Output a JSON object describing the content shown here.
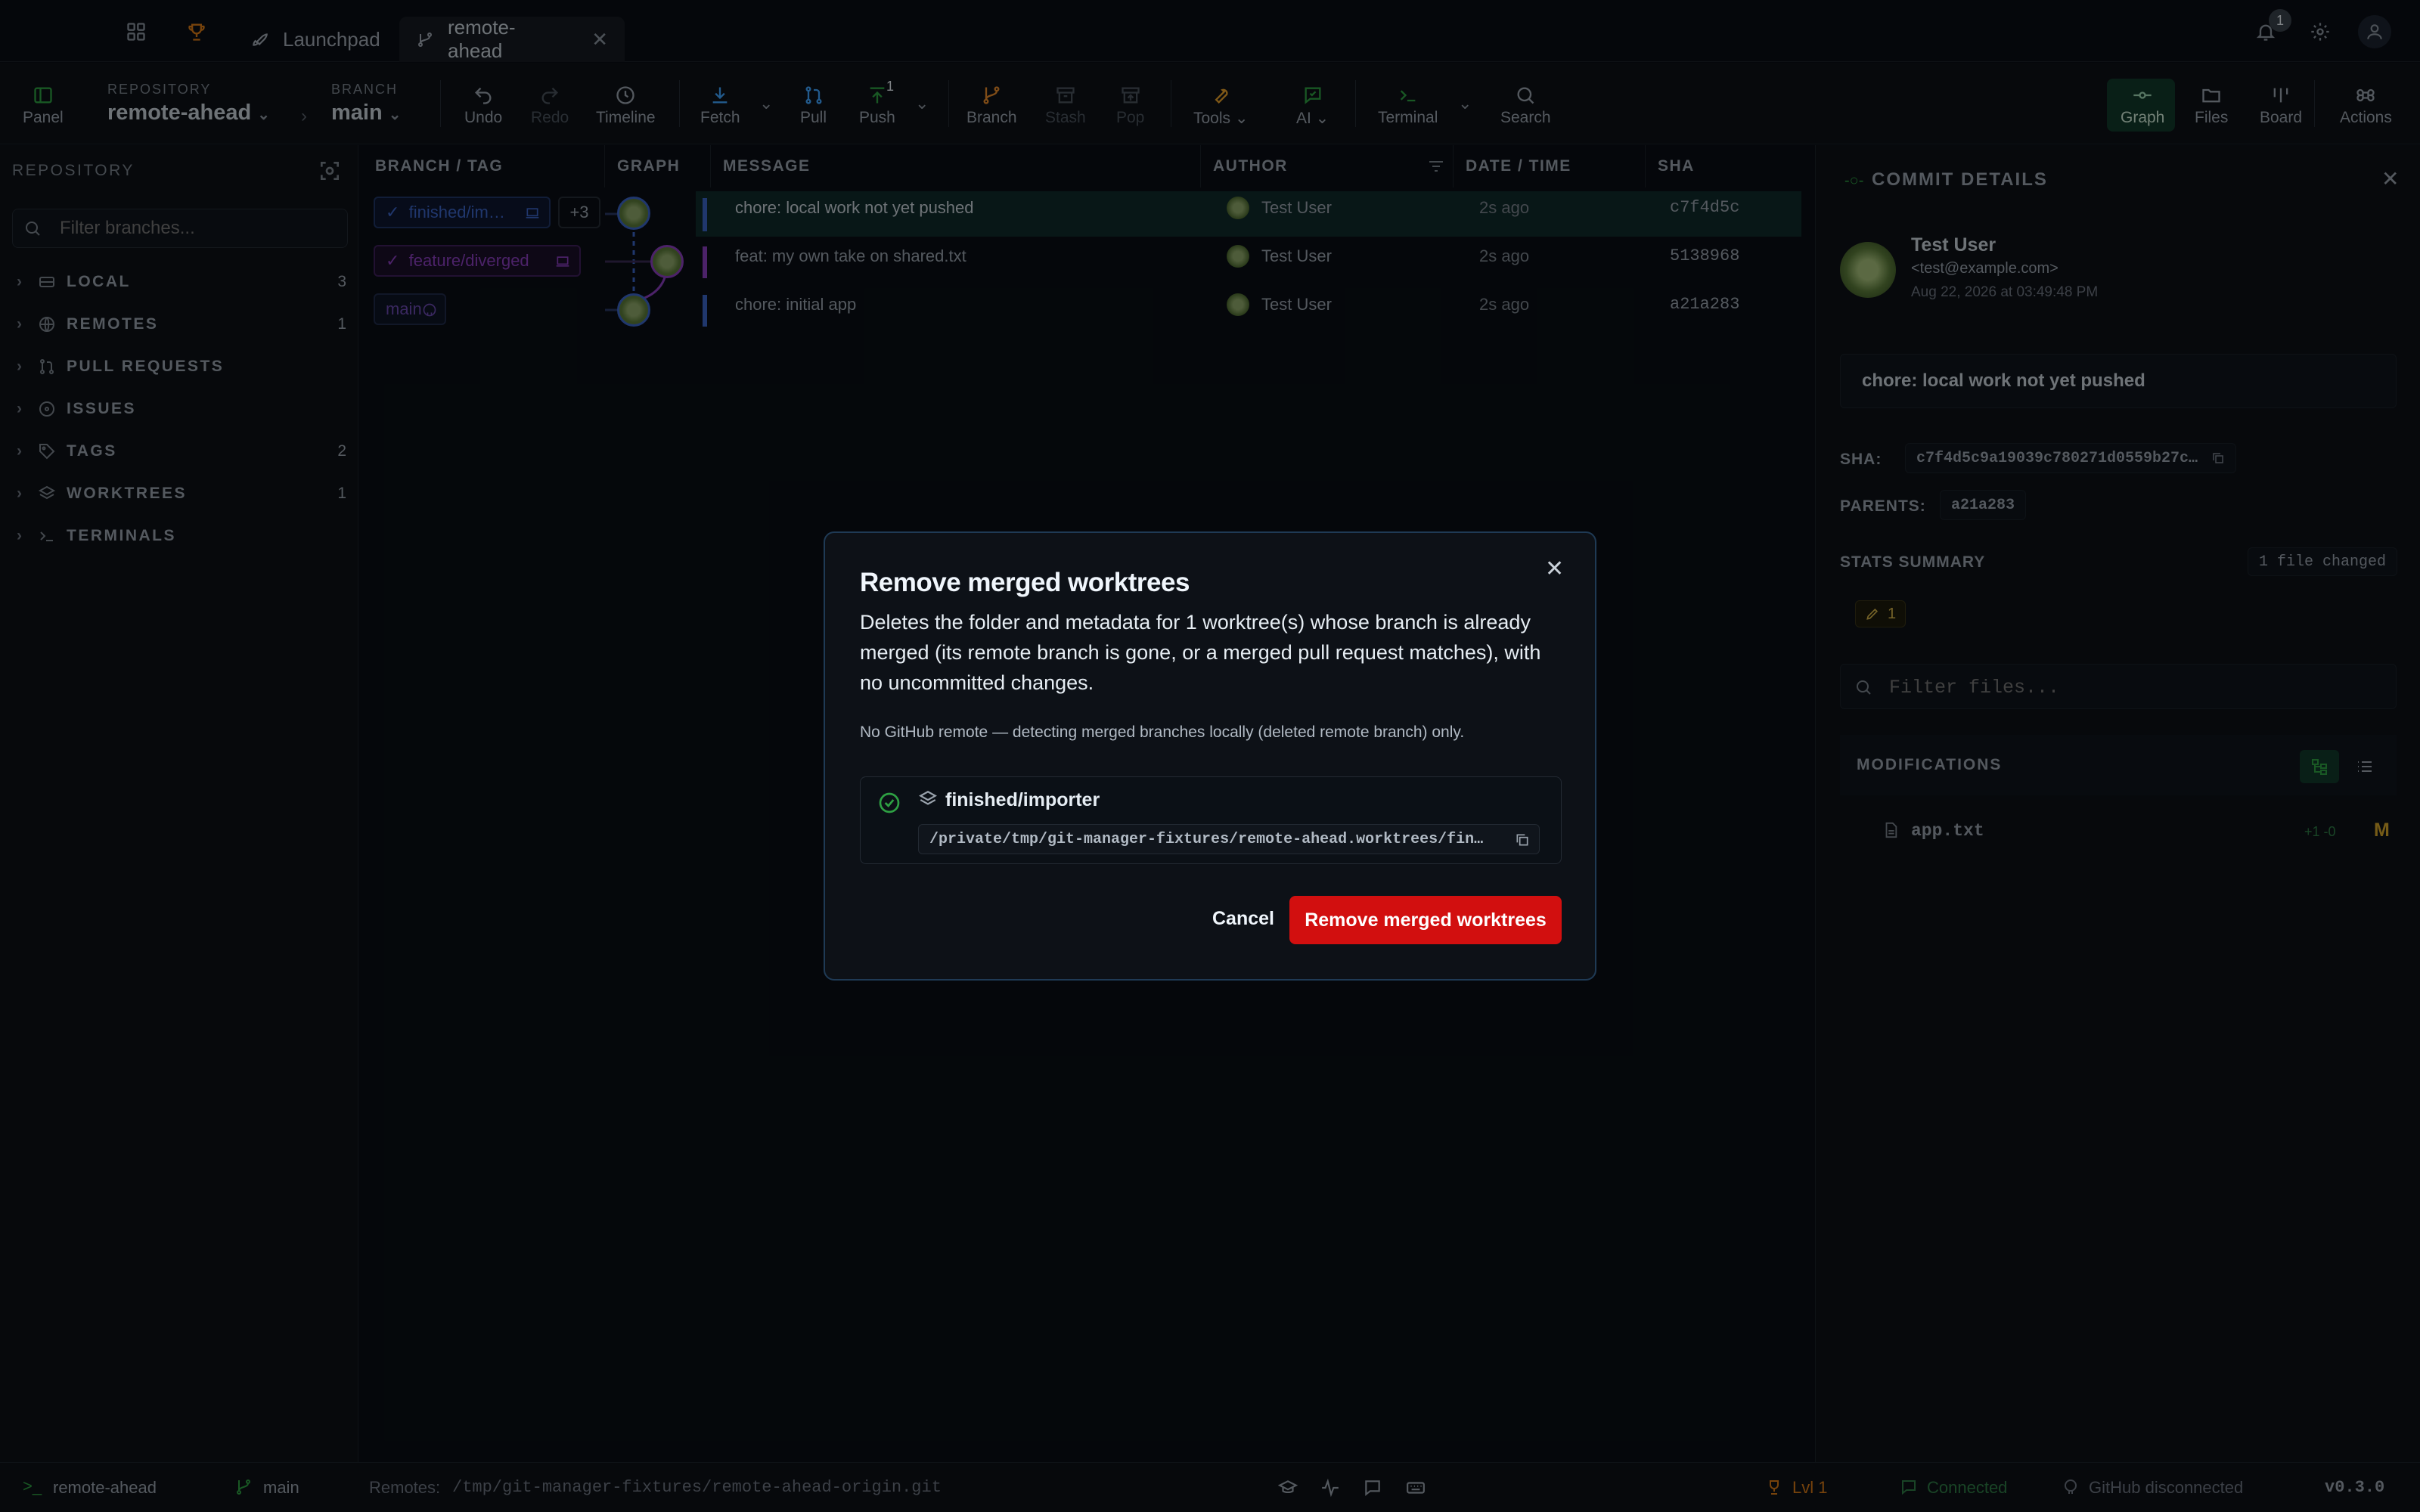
{
  "tabs": [
    {
      "label": "Launchpad"
    },
    {
      "label": "remote-ahead"
    }
  ],
  "notifications": {
    "count": "1"
  },
  "toolbar": {
    "panel_label": "Panel",
    "repository_caption": "REPOSITORY",
    "repository_name": "remote-ahead",
    "branch_caption": "BRANCH",
    "branch_name": "main",
    "undo": "Undo",
    "redo": "Redo",
    "timeline": "Timeline",
    "fetch": "Fetch",
    "pull": "Pull",
    "push": "Push",
    "push_badge": "1",
    "branch": "Branch",
    "stash": "Stash",
    "pop": "Pop",
    "tools": "Tools",
    "ai": "AI",
    "terminal": "Terminal",
    "search": "Search",
    "graph": "Graph",
    "files": "Files",
    "board": "Board",
    "actions": "Actions"
  },
  "sidebar": {
    "title": "REPOSITORY",
    "filter_placeholder": "Filter branches...",
    "sections": [
      {
        "label": "LOCAL",
        "count": "3"
      },
      {
        "label": "REMOTES",
        "count": "1"
      },
      {
        "label": "PULL REQUESTS",
        "count": ""
      },
      {
        "label": "ISSUES",
        "count": ""
      },
      {
        "label": "TAGS",
        "count": "2"
      },
      {
        "label": "WORKTREES",
        "count": "1"
      },
      {
        "label": "TERMINALS",
        "count": ""
      }
    ]
  },
  "graph": {
    "columns": [
      "BRANCH / TAG",
      "GRAPH",
      "MESSAGE",
      "AUTHOR",
      "DATE / TIME",
      "SHA"
    ],
    "rows": [
      {
        "branch": "finished/im…",
        "extra": "+3",
        "message": "chore: local work not yet pushed",
        "author": "Test User",
        "date": "2s ago",
        "sha": "c7f4d5c"
      },
      {
        "branch": "feature/diverged",
        "extra": "",
        "message": "feat: my own take on shared.txt",
        "author": "Test User",
        "date": "2s ago",
        "sha": "5138968"
      },
      {
        "branch": "main",
        "extra": "",
        "message": "chore: initial app",
        "author": "Test User",
        "date": "2s ago",
        "sha": "a21a283"
      }
    ]
  },
  "details": {
    "title": "COMMIT DETAILS",
    "author": "Test User",
    "email": "<test@example.com>",
    "date": "Aug 22, 2026 at 03:49:48 PM",
    "message": "chore: local work not yet pushed",
    "sha_label": "SHA:",
    "sha": "c7f4d5c9a19039c780271d0559b27c…",
    "parents_label": "PARENTS:",
    "parent": "a21a283",
    "stats_label": "STATS SUMMARY",
    "files_changed": "1 file changed",
    "modified_count": "1",
    "filter_placeholder": "Filter files...",
    "modifications_label": "MODIFICATIONS",
    "file": {
      "name": "app.txt",
      "diff": "+1 -0",
      "status": "M"
    }
  },
  "status": {
    "repo": "remote-ahead",
    "branch": "main",
    "remotes_label": "Remotes:",
    "remotes_path": "/tmp/git-manager-fixtures/remote-ahead-origin.git",
    "level": "Lvl 1",
    "connected": "Connected",
    "github": "GitHub disconnected",
    "version": "v0.3.0"
  },
  "dialog": {
    "title": "Remove merged worktrees",
    "description": "Deletes the folder and metadata for 1 worktree(s) whose branch is already merged (its remote branch is gone, or a merged pull request matches), with no uncommitted changes.",
    "note": "No GitHub remote — detecting merged branches locally (deleted remote branch) only.",
    "item_name": "finished/importer",
    "item_path": "/private/tmp/git-manager-fixtures/remote-ahead.worktrees/fin…",
    "cancel": "Cancel",
    "confirm": "Remove merged worktrees"
  },
  "colors": {
    "accent": "#2ea043",
    "danger": "#d20f0f",
    "blue_branch": "#3b64c7",
    "purple_branch": "#8b3fc0"
  }
}
